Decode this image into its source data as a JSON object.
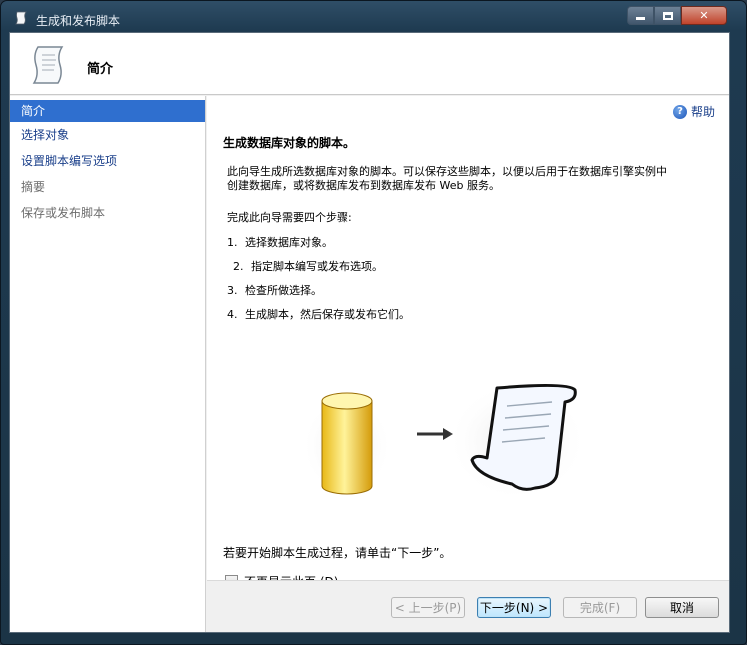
{
  "window": {
    "title": "生成和发布脚本"
  },
  "header": {
    "title": "简介"
  },
  "sidebar": {
    "items": [
      {
        "label": "简介",
        "state": "active"
      },
      {
        "label": "选择对象",
        "state": "link"
      },
      {
        "label": "设置脚本编写选项",
        "state": "link"
      },
      {
        "label": "摘要",
        "state": "disabled"
      },
      {
        "label": "保存或发布脚本",
        "state": "disabled"
      }
    ]
  },
  "content": {
    "help_label": "帮助",
    "heading": "生成数据库对象的脚本。",
    "intro_line1": "此向导生成所选数据库对象的脚本。可以保存这些脚本，以便以后用于在数据库引擎实例中",
    "intro_line2": "创建数据库，或将数据库发布到数据库发布 Web 服务。",
    "steps_title": "完成此向导需要四个步骤:",
    "steps": [
      {
        "num": "1.",
        "text": "选择数据库对象。"
      },
      {
        "num": "2.",
        "text": "指定脚本编写或发布选项。"
      },
      {
        "num": "3.",
        "text": "检查所做选择。"
      },
      {
        "num": "4.",
        "text": "生成脚本，然后保存或发布它们。"
      }
    ],
    "start_text": "若要开始脚本生成过程，请单击“下一步”。",
    "checkbox_label": "不再显示此页 (D)。",
    "checkbox_checked": false
  },
  "footer": {
    "prev_label": "< 上一步(P)",
    "next_label": "下一步(N) >",
    "finish_label": "完成(F)",
    "cancel_label": "取消"
  },
  "icons": {
    "title": "script-scroll-icon",
    "header": "script-scroll-icon",
    "help": "help-icon",
    "database": "database-icon",
    "arrow": "arrow-right-icon",
    "scroll": "script-scroll-icon"
  },
  "colors": {
    "accent": "#2f6fcf",
    "link": "#1a3f8a"
  }
}
